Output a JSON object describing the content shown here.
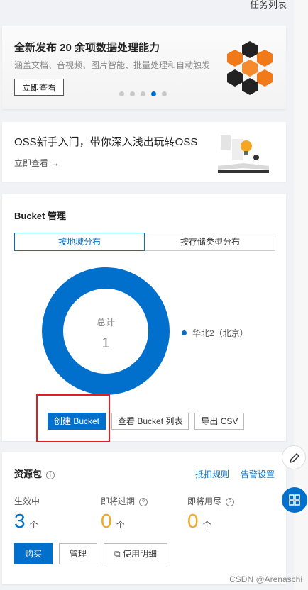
{
  "top_link": "任务列表",
  "promo": {
    "title": "全新发布 20 余项数据处理能力",
    "subtitle": "涵盖文档、音视频、图片智能、批量处理和自动触发",
    "button": "立即查看",
    "carousel_dots": 5,
    "active_dot": 4
  },
  "intro": {
    "title": "OSS新手入门，带你深入浅出玩转OSS",
    "link": "立即查看 →"
  },
  "bucket": {
    "title": "Bucket 管理",
    "tabs": [
      "按地域分布",
      "按存储类型分布"
    ],
    "active_tab": 0,
    "total_label": "总计",
    "total_value": "1",
    "actions": [
      "创建 Bucket",
      "查看 Bucket 列表",
      "导出 CSV"
    ]
  },
  "chart_data": {
    "type": "pie",
    "categories": [
      "华北2（北京）"
    ],
    "values": [
      1
    ],
    "colors": [
      "#0070cc"
    ],
    "center_label": "总计",
    "center_value": "1",
    "legend_position": "right"
  },
  "resource": {
    "title": "资源包",
    "links": [
      "抵扣规则",
      "告警设置"
    ],
    "stats": [
      {
        "label": "生效中",
        "value": "3",
        "unit": "个",
        "color": "#0070cc"
      },
      {
        "label": "即将过期",
        "value": "0",
        "unit": "个",
        "color": "#f5a623"
      },
      {
        "label": "即将用尽",
        "value": "0",
        "unit": "个",
        "color": "#f5a623"
      }
    ],
    "buttons": [
      "购买",
      "管理",
      "使用明细"
    ]
  },
  "watermark": "CSDN @Arenaschi",
  "colors": {
    "accent": "#0070cc",
    "annotation": "#e02020",
    "warning": "#f5a623"
  }
}
